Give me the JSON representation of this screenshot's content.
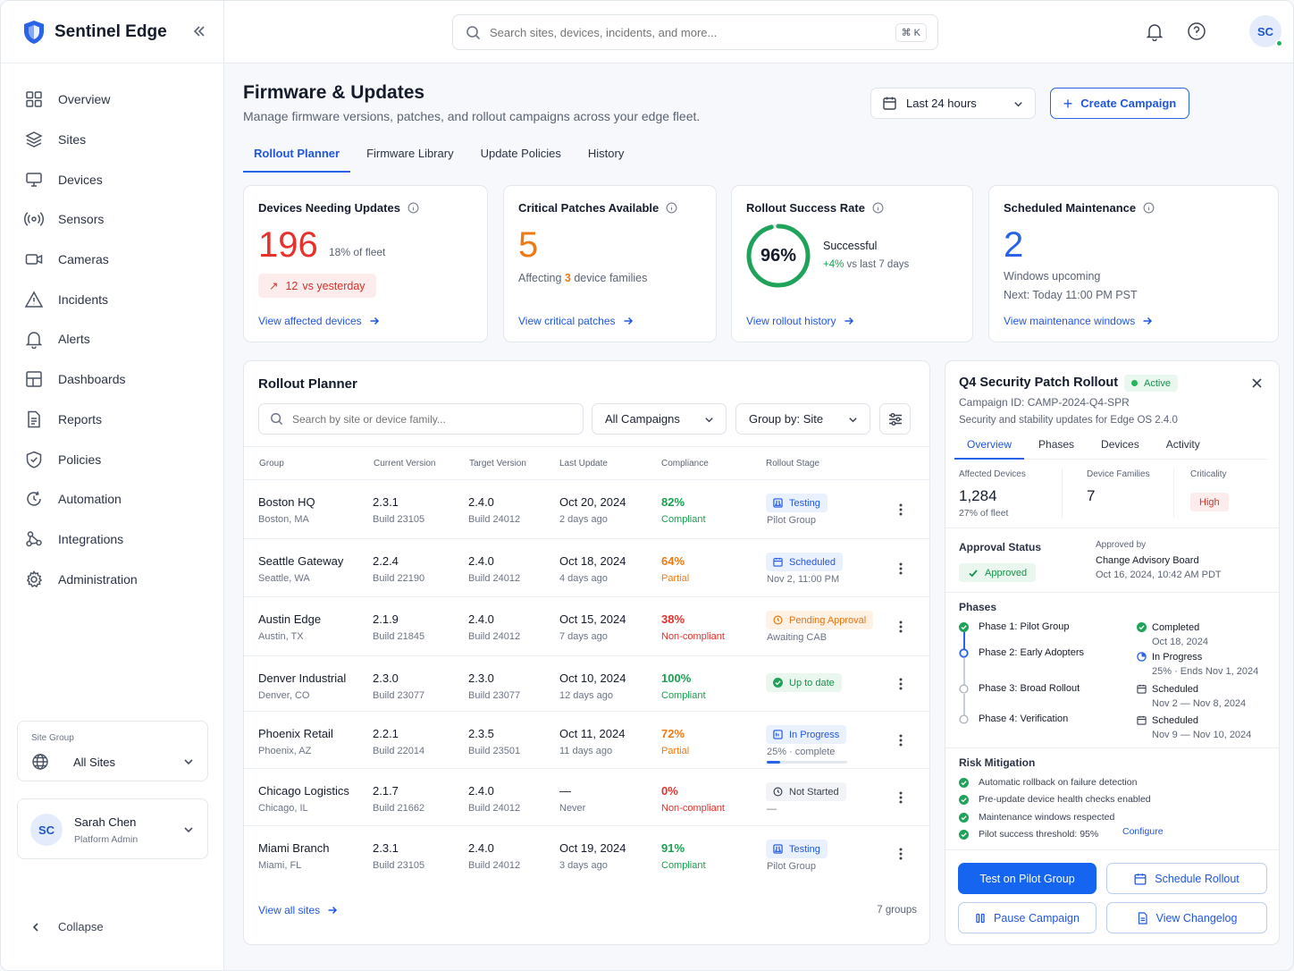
{
  "brand": {
    "name": "Sentinel Edge"
  },
  "nav": [
    {
      "label": "Overview",
      "icon": "overview-icon"
    },
    {
      "label": "Sites",
      "icon": "sites-icon"
    },
    {
      "label": "Devices",
      "icon": "devices-icon"
    },
    {
      "label": "Sensors",
      "icon": "sensors-icon"
    },
    {
      "label": "Cameras",
      "icon": "cameras-icon"
    },
    {
      "label": "Incidents",
      "icon": "incidents-icon"
    },
    {
      "label": "Alerts",
      "icon": "alerts-icon"
    },
    {
      "label": "Dashboards",
      "icon": "dashboards-icon"
    },
    {
      "label": "Reports",
      "icon": "reports-icon"
    },
    {
      "label": "Policies",
      "icon": "policies-icon"
    },
    {
      "label": "Automation",
      "icon": "automation-icon"
    },
    {
      "label": "Integrations",
      "icon": "integrations-icon"
    },
    {
      "label": "Administration",
      "icon": "administration-icon"
    }
  ],
  "site_group": {
    "label": "Site Group",
    "value": "All Sites"
  },
  "user": {
    "initials": "SC",
    "name": "Sarah Chen",
    "role": "Platform Admin"
  },
  "collapse_label": "Collapse",
  "search": {
    "placeholder": "Search sites, devices, incidents, and more...",
    "shortcut": "⌘ K"
  },
  "header": {
    "title": "Firmware & Updates",
    "subtitle": "Manage firmware versions, patches, and rollout campaigns across your edge fleet.",
    "range": "Last 24 hours",
    "create_label": "Create Campaign"
  },
  "tabs": [
    {
      "label": "Rollout Planner",
      "active": true
    },
    {
      "label": "Firmware Library",
      "active": false
    },
    {
      "label": "Update Policies",
      "active": false
    },
    {
      "label": "History",
      "active": false
    }
  ],
  "kpis": {
    "devices": {
      "title": "Devices Needing Updates",
      "value": "196",
      "pct": "18% of fleet",
      "delta_arrow": "↗",
      "delta": "12",
      "delta_text": "vs yesterday",
      "link": "View affected devices"
    },
    "patches": {
      "title": "Critical Patches Available",
      "value": "5",
      "sub_pre": "Affecting",
      "sub_num": "3",
      "sub_post": "device families",
      "link": "View critical patches"
    },
    "success": {
      "title": "Rollout Success Rate",
      "value": "96%",
      "fraction": 0.96,
      "label": "Successful",
      "delta": "+4%",
      "delta_text": "vs last 7 days",
      "link": "View rollout history"
    },
    "maintenance": {
      "title": "Scheduled Maintenance",
      "value": "2",
      "sub": "Windows upcoming",
      "next": "Next: Today 11:00 PM PST",
      "link": "View maintenance windows"
    }
  },
  "planner": {
    "title": "Rollout Planner",
    "search_placeholder": "Search by site or device family...",
    "campaign_filter": "All Campaigns",
    "group_by": "Group by: Site",
    "columns": [
      "Group",
      "Current Version",
      "Target Version",
      "Last Update",
      "Compliance",
      "Rollout Stage"
    ],
    "rows": [
      {
        "name": "Boston HQ",
        "loc": "Boston, MA",
        "cur": "2.3.1",
        "cur_build": "Build 23105",
        "tgt": "2.4.0",
        "tgt_build": "Build 24012",
        "date": "Oct 20, 2024",
        "ago": "2 days ago",
        "pct": "82%",
        "comp": "Compliant",
        "level": "green",
        "stage": "Testing",
        "stage_kind": "blue",
        "stage_icon": "flask-icon",
        "stage_sub": "Pilot Group"
      },
      {
        "name": "Seattle Gateway",
        "loc": "Seattle, WA",
        "cur": "2.2.4",
        "cur_build": "Build 22190",
        "tgt": "2.4.0",
        "tgt_build": "Build 24012",
        "date": "Oct 18, 2024",
        "ago": "4 days ago",
        "pct": "64%",
        "comp": "Partial",
        "level": "orange",
        "stage": "Scheduled",
        "stage_kind": "blue",
        "stage_icon": "calendar-icon",
        "stage_sub": "Nov 2, 11:00 PM"
      },
      {
        "name": "Austin Edge",
        "loc": "Austin, TX",
        "cur": "2.1.9",
        "cur_build": "Build 21845",
        "tgt": "2.4.0",
        "tgt_build": "Build 24012",
        "date": "Oct 15, 2024",
        "ago": "7 days ago",
        "pct": "38%",
        "comp": "Non-compliant",
        "level": "red",
        "stage": "Pending Approval",
        "stage_kind": "orange",
        "stage_icon": "clock-icon",
        "stage_sub": "Awaiting CAB"
      },
      {
        "name": "Denver Industrial",
        "loc": "Denver, CO",
        "cur": "2.3.0",
        "cur_build": "Build 23077",
        "tgt": "2.3.0",
        "tgt_build": "Build 23077",
        "date": "Oct 10, 2024",
        "ago": "12 days ago",
        "pct": "100%",
        "comp": "Compliant",
        "level": "green",
        "stage": "Up to date",
        "stage_kind": "green",
        "stage_icon": "check-circle-icon",
        "stage_sub": ""
      },
      {
        "name": "Phoenix Retail",
        "loc": "Phoenix, AZ",
        "cur": "2.2.1",
        "cur_build": "Build 22014",
        "tgt": "2.3.5",
        "tgt_build": "Build 23501",
        "date": "Oct 11, 2024",
        "ago": "11 days ago",
        "pct": "72%",
        "comp": "Partial",
        "level": "orange",
        "stage": "In Progress",
        "stage_kind": "blue",
        "stage_icon": "progress-icon",
        "stage_sub": "25% · complete",
        "progress": 0.25
      },
      {
        "name": "Chicago Logistics",
        "loc": "Chicago, IL",
        "cur": "2.1.7",
        "cur_build": "Build 21662",
        "tgt": "2.4.0",
        "tgt_build": "Build 24012",
        "date": "—",
        "ago": "Never",
        "pct": "0%",
        "comp": "Non-compliant",
        "level": "red",
        "stage": "Not Started",
        "stage_kind": "grey",
        "stage_icon": "clock-icon",
        "stage_sub": "—"
      },
      {
        "name": "Miami Branch",
        "loc": "Miami, FL",
        "cur": "2.3.1",
        "cur_build": "Build 23105",
        "tgt": "2.4.0",
        "tgt_build": "Build 24012",
        "date": "Oct 19, 2024",
        "ago": "3 days ago",
        "pct": "91%",
        "comp": "Compliant",
        "level": "green",
        "stage": "Testing",
        "stage_kind": "blue",
        "stage_icon": "flask-icon",
        "stage_sub": "Pilot Group"
      }
    ],
    "footer_link": "View all sites",
    "footer_count": "7 groups"
  },
  "campaign": {
    "title": "Q4 Security Patch Rollout",
    "status": "Active",
    "id": "Campaign ID: CAMP-2024-Q4-SPR",
    "desc": "Security and stability updates for Edge OS 2.4.0",
    "tabs": [
      "Overview",
      "Phases",
      "Devices",
      "Activity"
    ],
    "stats": {
      "affected_label": "Affected Devices",
      "affected": "1,284",
      "affected_sub": "27% of fleet",
      "families_label": "Device Families",
      "families": "7",
      "criticality_label": "Criticality",
      "criticality": "High"
    },
    "approval": {
      "label": "Approval Status",
      "status": "Approved",
      "by_label": "Approved by",
      "by": "Change Advisory Board",
      "date": "Oct 16, 2024, 10:42 AM PDT"
    },
    "phases_title": "Phases",
    "phases": [
      {
        "name": "Phase 1: Pilot Group",
        "status": "Completed",
        "date": "Oct 18, 2024",
        "state": "done"
      },
      {
        "name": "Phase 2: Early Adopters",
        "status": "In Progress",
        "date": "25%  ·  Ends Nov 1, 2024",
        "state": "current"
      },
      {
        "name": "Phase 3: Broad Rollout",
        "status": "Scheduled",
        "date": "Nov 2  —  Nov 8, 2024",
        "state": "pending"
      },
      {
        "name": "Phase 4: Verification",
        "status": "Scheduled",
        "date": "Nov 9  —  Nov 10, 2024",
        "state": "pending"
      }
    ],
    "risk_title": "Risk Mitigation",
    "risks": [
      "Automatic rollback on failure detection",
      "Pre-update device health checks enabled",
      "Maintenance windows respected",
      "Pilot success threshold: 95%"
    ],
    "configure": "Configure",
    "buttons": {
      "test": "Test on Pilot Group",
      "schedule": "Schedule Rollout",
      "pause": "Pause Campaign",
      "changelog": "View Changelog"
    }
  },
  "colors": {
    "accent": "#2a63e6",
    "danger": "#e5322d",
    "warning": "#f07a12",
    "success": "#18a04e"
  }
}
